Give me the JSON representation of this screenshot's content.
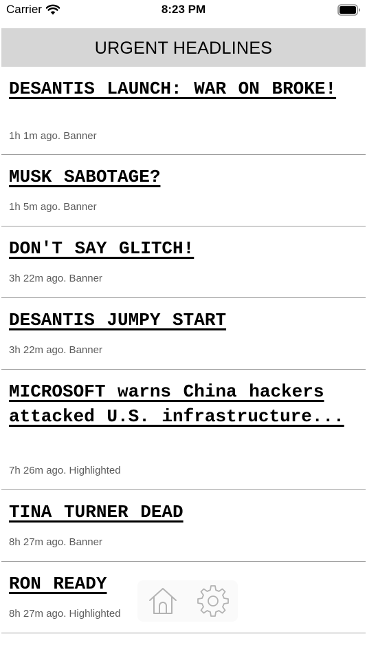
{
  "status_bar": {
    "carrier": "Carrier",
    "time": "8:23 PM",
    "wifi_icon": "wifi-icon",
    "battery_icon": "battery-full-icon"
  },
  "header": {
    "title": "URGENT HEADLINES"
  },
  "feed": {
    "items": [
      {
        "headline": "DESANTIS LAUNCH: WAR ON BROKE!",
        "meta": "1h 1m ago. Banner"
      },
      {
        "headline": "MUSK SABOTAGE?",
        "meta": "1h 5m ago. Banner"
      },
      {
        "headline": "DON'T SAY GLITCH!",
        "meta": "3h 22m ago. Banner"
      },
      {
        "headline": "DESANTIS JUMPY START",
        "meta": "3h 22m ago. Banner"
      },
      {
        "headline": "MICROSOFT warns China hackers attacked U.S. infrastructure...",
        "meta": "7h 26m ago. Highlighted"
      },
      {
        "headline": "TINA TURNER DEAD",
        "meta": "8h 27m ago. Banner"
      },
      {
        "headline": "RON READY",
        "meta": "8h 27m ago. Highlighted"
      }
    ]
  },
  "tabbar": {
    "home_icon": "home-icon",
    "settings_icon": "gear-icon"
  },
  "colors": {
    "header_background": "#d6d6d6",
    "separator": "#9e9e9e",
    "meta_text": "#5c5c5c",
    "tab_icon": "#b3b3b3"
  }
}
